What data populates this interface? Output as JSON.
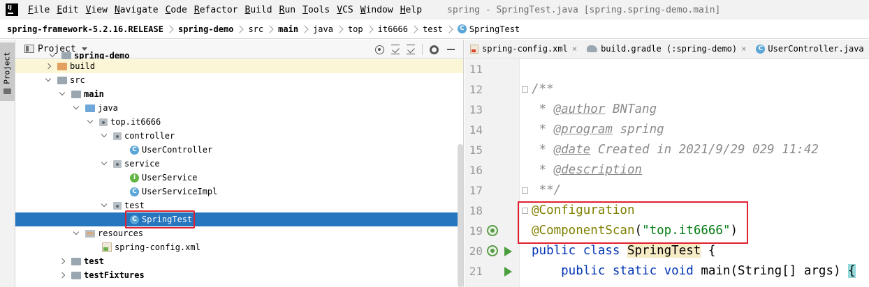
{
  "menubar": {
    "items": [
      "File",
      "Edit",
      "View",
      "Navigate",
      "Code",
      "Refactor",
      "Build",
      "Run",
      "Tools",
      "VCS",
      "Window",
      "Help"
    ],
    "window_title": "spring - SpringTest.java [spring.spring-demo.main]"
  },
  "breadcrumb": {
    "items": [
      "spring-framework-5.2.16.RELEASE",
      "spring-demo",
      "src",
      "main",
      "java",
      "top",
      "it6666",
      "test",
      "SpringTest"
    ]
  },
  "toolstrip": {
    "project_tab": "Project"
  },
  "project_panel": {
    "title": "Project",
    "icons": [
      "locate-icon",
      "expand-all-icon",
      "collapse-all-icon",
      "gear-icon",
      "hide-icon"
    ],
    "tree": [
      {
        "label": "spring-demo",
        "icon": "folder",
        "depth": 1
      },
      {
        "label": "build",
        "icon": "folder-orange",
        "depth": 2
      },
      {
        "label": "src",
        "icon": "folder",
        "depth": 2
      },
      {
        "label": "main",
        "icon": "folder",
        "depth": 3
      },
      {
        "label": "java",
        "icon": "folder-blue",
        "depth": 4
      },
      {
        "label": "top.it6666",
        "icon": "package",
        "depth": 5
      },
      {
        "label": "controller",
        "icon": "package",
        "depth": 6
      },
      {
        "label": "UserController",
        "icon": "class",
        "depth": 7
      },
      {
        "label": "service",
        "icon": "package",
        "depth": 6
      },
      {
        "label": "UserService",
        "icon": "interface",
        "depth": 7
      },
      {
        "label": "UserServiceImpl",
        "icon": "class",
        "depth": 7
      },
      {
        "label": "test",
        "icon": "package",
        "depth": 6
      },
      {
        "label": "SpringTest",
        "icon": "class",
        "depth": 7
      },
      {
        "label": "resources",
        "icon": "resources",
        "depth": 4
      },
      {
        "label": "spring-config.xml",
        "icon": "xml",
        "depth": 5
      },
      {
        "label": "test",
        "icon": "folder",
        "depth": 3
      },
      {
        "label": "testFixtures",
        "icon": "folder",
        "depth": 3
      }
    ]
  },
  "editor": {
    "tabs": [
      "spring-config.xml",
      "build.gradle (:spring-demo)",
      "UserController.java"
    ],
    "tab_close": "×",
    "line_numbers": [
      "11",
      "12",
      "13",
      "14",
      "15",
      "16",
      "17",
      "18",
      "19",
      "20",
      "21"
    ],
    "code": {
      "l12": "/**",
      "l13_star": " * ",
      "l13_tag": "@author",
      "l13_text": " BNTang",
      "l14_tag": "@program",
      "l14_text": " spring",
      "l15_tag": "@date",
      "l15_text": " Created in 2021/9/29 029 11:42",
      "l16_tag": "@description",
      "l17": " **/",
      "l18": "@Configuration",
      "l19_anno": "@ComponentScan",
      "l19_open": "(",
      "l19_str": "\"top.it6666\"",
      "l19_close": ")",
      "l20_kw": "public class ",
      "l20_cls": "SpringTest",
      "l20_rest": " {",
      "l21_kw": "    public static void ",
      "l21_rest": "main(String[] args) ",
      "l21_brace": "{"
    }
  },
  "colors": {
    "selection": "#2675bf",
    "annotation_box": "#e0202f",
    "annotation": "#808000",
    "string": "#067d17",
    "keyword": "#0033b3"
  }
}
